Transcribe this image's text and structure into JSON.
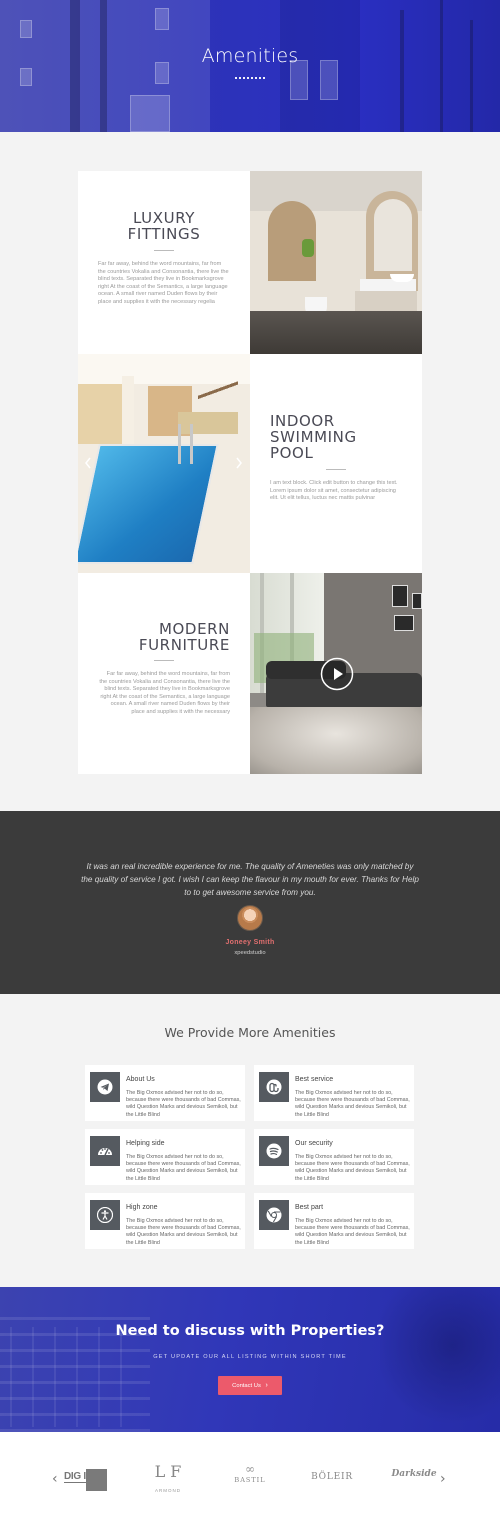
{
  "hero": {
    "title": "Amenities"
  },
  "amenities": [
    {
      "title_lines": [
        "LUXURY",
        "FITTINGS"
      ],
      "text": "Far far away, behind the word mountains, far from the countries Vokalia and Consonantia, there live the blind texts. Separated they live in Bookmarksgrove right  At the coast of the Semantics, a large language ocean. A small river named Duden flows by their place and supplies it with the necessary regelia"
    },
    {
      "title_lines": [
        "INDOOR",
        "SWIMMING",
        "POOL"
      ],
      "text": "I am text block. Click edit button to change this text. Lorem ipsum dolor sit amet, consectetur adipiscing elit. Ut elit tellus, luctus nec mattis pulvinar"
    },
    {
      "title_lines": [
        "MODERN",
        "FURNITURE"
      ],
      "text": "Far far away, behind the word mountains, far from the countries Vokalia and Consonantia, there live the blind texts. Separated they live in Bookmarksgrove right  At the coast of the Semantics, a large language ocean. A small river named Duden flows by their place and supplies it with the necessary"
    }
  ],
  "carousel": {
    "prev_icon": "chevron-left-icon",
    "next_icon": "chevron-right-icon"
  },
  "video": {
    "icon": "play-icon"
  },
  "testimonial": {
    "quote": "It was an real incredible experience for me. The quality of Ameneties was only matched by the quality of service I got. I wish I can keep the flavour in my mouth for ever. Thanks for Help to to get awesome service from you.",
    "name": "Joneey Smith",
    "company": "xpeedstudio"
  },
  "more": {
    "title": "We Provide More Amenities",
    "items": [
      {
        "title": "About Us",
        "icon": "telegram-icon",
        "text": "The Big Oxmox advised her not to do so, because there were thousands of bad Commas, wild Question Marks and devious Semikoli, but the Little Blind"
      },
      {
        "title": "Best service",
        "icon": "stumbleupon-icon",
        "text": "The Big Oxmox advised her not to do so, because there were thousands of bad Commas, wild Question Marks and devious Semikoli, but the Little Blind"
      },
      {
        "title": "Helping side",
        "icon": "dashboard-icon",
        "text": "The Big Oxmox advised her not to do so, because there were thousands of bad Commas, wild Question Marks and devious Semikoli, but the Little Blind"
      },
      {
        "title": "Our security",
        "icon": "spotify-icon",
        "text": "The Big Oxmox advised her not to do so, because there were thousands of bad Commas, wild Question Marks and devious Semikoli, but the Little Blind"
      },
      {
        "title": "High zone",
        "icon": "accessibility-icon",
        "text": "The Big Oxmox advised her not to do so, because there were thousands of bad Commas, wild Question Marks and devious Semikoli, but the Little Blind"
      },
      {
        "title": "Best part",
        "icon": "chrome-icon",
        "text": "The Big Oxmox advised her not to do so, because there were thousands of bad Commas, wild Question Marks and devious Semikoli, but the Little Blind"
      }
    ]
  },
  "cta": {
    "title": "Need to discuss with Properties?",
    "subtitle": "GET UPDATE OUR ALL LISTING WITHIN SHORT TIME",
    "button": "Contact Us"
  },
  "logos": {
    "prev_icon": "chevron-left-icon",
    "next_icon": "chevron-right-icon",
    "items": [
      {
        "name": "DIG IT"
      },
      {
        "name": "ARMOND"
      },
      {
        "name": "BASTIL"
      },
      {
        "name": "BÖLEIR"
      },
      {
        "name": "Darkside"
      }
    ]
  },
  "colors": {
    "hero_blue": "#2d33b8",
    "dark_band": "#3b3b3b",
    "accent_red": "#ec5a6b",
    "name_red": "#e06f6f"
  }
}
